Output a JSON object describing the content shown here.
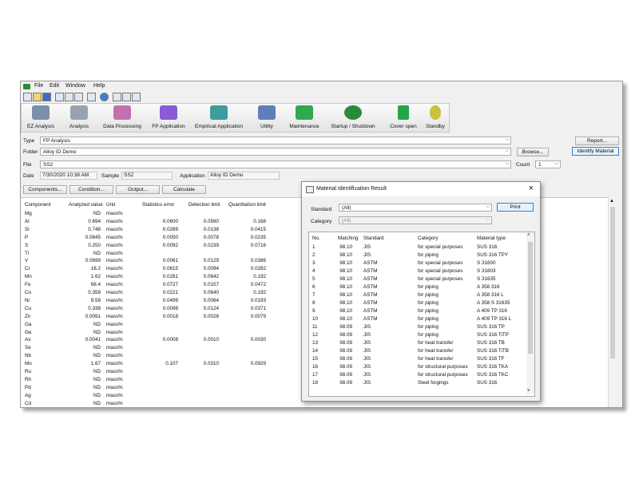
{
  "menu": [
    "File",
    "Edit",
    "Window",
    "Help"
  ],
  "ribbon": [
    {
      "label": "EZ Analysis",
      "icon": "ez-analysis-icon",
      "color": "#7a8fa8"
    },
    {
      "label": "Analysis",
      "icon": "analysis-icon",
      "color": "#9aa3ad"
    },
    {
      "label": "Data Processing",
      "icon": "data-processing-icon",
      "color": "#c66fb0"
    },
    {
      "label": "FP Application",
      "icon": "fp-application-icon",
      "color": "#8a5bd6"
    },
    {
      "label": "Empirical Application",
      "icon": "empirical-application-icon",
      "color": "#3d9c9c"
    },
    {
      "label": "Utility",
      "icon": "utility-icon",
      "color": "#5f7fb8"
    },
    {
      "label": "Maintenance",
      "icon": "maintenance-icon",
      "color": "#2fa84f"
    },
    {
      "label": "Startup / Shutdown",
      "icon": "startup-shutdown-icon",
      "color": "#2b8a3a"
    },
    {
      "label": "Cover open",
      "icon": "cover-open-icon",
      "color": "#27a34b"
    },
    {
      "label": "Standby",
      "icon": "standby-icon",
      "color": "#c9c23a"
    }
  ],
  "form": {
    "type_label": "Type",
    "type_value": "FP Analysis",
    "folder_label": "Folder",
    "folder_value": "Alloy ID Demo",
    "file_label": "File",
    "file_value": "SS2",
    "count_label": "Count",
    "count_value": "1",
    "date_label": "Date",
    "date_value": "7/30/2020 10:38 AM",
    "sample_label": "Sample",
    "sample_value": "SS2",
    "application_label": "Application",
    "application_value": "Alloy ID Demo",
    "report_button": "Report...",
    "browse_button": "Browse...",
    "identify_button": "Identify Material"
  },
  "actions": [
    "Components...",
    "Condition...",
    "Output...",
    "Calculate"
  ],
  "table": {
    "headers": [
      "Component",
      "Analyzed value",
      "Unit",
      "Statistics error",
      "Detection limit",
      "Quantitation limit"
    ],
    "rows": [
      [
        "Mg",
        "ND",
        "mass%",
        "",
        "",
        ""
      ],
      [
        "Al",
        "0.694",
        "mass%",
        "0.0600",
        "0.0560",
        "0.168"
      ],
      [
        "Si",
        "0.748",
        "mass%",
        "0.0269",
        "0.0138",
        "0.0415"
      ],
      [
        "P",
        "0.0845",
        "mass%",
        "0.0050",
        "0.0078",
        "0.0235"
      ],
      [
        "S",
        "0.250",
        "mass%",
        "0.0092",
        "0.0239",
        "0.0716"
      ],
      [
        "Ti",
        "ND",
        "mass%",
        "",
        "",
        ""
      ],
      [
        "V",
        "0.0699",
        "mass%",
        "0.0061",
        "0.0129",
        "0.0386"
      ],
      [
        "Cr",
        "16.2",
        "mass%",
        "0.0615",
        "0.0094",
        "0.0282"
      ],
      [
        "Mn",
        "1.62",
        "mass%",
        "0.0281",
        "0.0642",
        "0.192"
      ],
      [
        "Fe",
        "68.4",
        "mass%",
        "0.0727",
        "0.0157",
        "0.0472"
      ],
      [
        "Co",
        "0.358",
        "mass%",
        "0.0221",
        "0.0640",
        "0.192"
      ],
      [
        "Ni",
        "9.58",
        "mass%",
        "0.0499",
        "0.0064",
        "0.0193"
      ],
      [
        "Cu",
        "0.338",
        "mass%",
        "0.0098",
        "0.0124",
        "0.0371"
      ],
      [
        "Zn",
        "0.0091",
        "mass%",
        "0.0018",
        "0.0026",
        "0.0079"
      ],
      [
        "Ga",
        "ND",
        "mass%",
        "",
        "",
        ""
      ],
      [
        "Ge",
        "ND",
        "mass%",
        "",
        "",
        ""
      ],
      [
        "As",
        "0.0041",
        "mass%",
        "0.0008",
        "0.0010",
        "0.0030"
      ],
      [
        "Se",
        "ND",
        "mass%",
        "",
        "",
        ""
      ],
      [
        "Nb",
        "ND",
        "mass%",
        "",
        "",
        ""
      ],
      [
        "Mo",
        "1.67",
        "mass%",
        "0.107",
        "0.0310",
        "0.0929"
      ],
      [
        "Ru",
        "ND",
        "mass%",
        "",
        "",
        ""
      ],
      [
        "Rh",
        "ND",
        "mass%",
        "",
        "",
        ""
      ],
      [
        "Pd",
        "ND",
        "mass%",
        "",
        "",
        ""
      ],
      [
        "Ag",
        "ND",
        "mass%",
        "",
        "",
        ""
      ],
      [
        "Cd",
        "ND",
        "mass%",
        "",
        "",
        ""
      ]
    ]
  },
  "dialog": {
    "title": "Material Identification Result",
    "close": "×",
    "standard_label": "Standard",
    "standard_value": "(All)",
    "category_label": "Category",
    "category_value": "(All)",
    "print_button": "Print",
    "headers": [
      "No.",
      "Matching",
      "Standard",
      "Category",
      "Material type"
    ],
    "rows": [
      [
        "1",
        "98.10",
        "JIS",
        "for special purposes",
        "SUS 316"
      ],
      [
        "2",
        "98.10",
        "JIS",
        "for piping",
        "SUS 316 TPY"
      ],
      [
        "3",
        "98.10",
        "ASTM",
        "for special purposes",
        "S 31600"
      ],
      [
        "4",
        "98.10",
        "ASTM",
        "for special purposes",
        "S 31603"
      ],
      [
        "5",
        "98.10",
        "ASTM",
        "for special purposes",
        "S 31635"
      ],
      [
        "6",
        "98.10",
        "ASTM",
        "for piping",
        "A 358 316"
      ],
      [
        "7",
        "98.10",
        "ASTM",
        "for piping",
        "A 358 316 L"
      ],
      [
        "8",
        "98.10",
        "ASTM",
        "for piping",
        "A 358 S 31635"
      ],
      [
        "9",
        "98.10",
        "ASTM",
        "for piping",
        "A 409 TP 316"
      ],
      [
        "10",
        "98.10",
        "ASTM",
        "for piping",
        "A 409 TP 316 L"
      ],
      [
        "11",
        "98.09",
        "JIS",
        "for piping",
        "SUS 316 TP"
      ],
      [
        "12",
        "98.09",
        "JIS",
        "for piping",
        "SUS 316 TiTP"
      ],
      [
        "13",
        "98.09",
        "JIS",
        "for heat transfer",
        "SUS 316 TB"
      ],
      [
        "14",
        "98.09",
        "JIS",
        "for heat transfer",
        "SUS 316 TiTB"
      ],
      [
        "15",
        "98.09",
        "JIS",
        "for heat transfer",
        "SUS 316 TF"
      ],
      [
        "16",
        "98.09",
        "JIS",
        "for structural purposes",
        "SUS 316 TKA"
      ],
      [
        "17",
        "98.09",
        "JIS",
        "for structural purposes",
        "SUS 316 TKC"
      ],
      [
        "18",
        "98.09",
        "JIS",
        "Steel forgings",
        "SUS 316"
      ]
    ]
  }
}
